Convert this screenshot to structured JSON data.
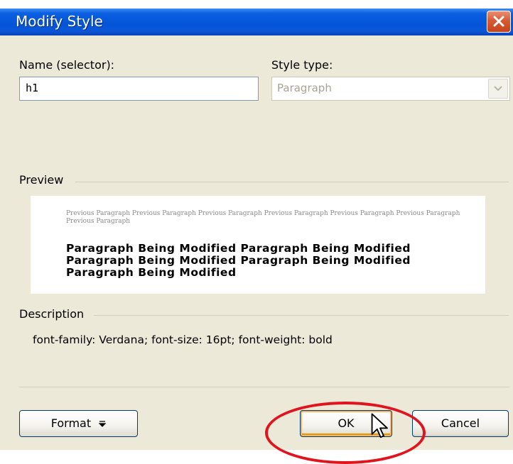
{
  "window": {
    "title": "Modify Style"
  },
  "name_field": {
    "label": "Name (selector):",
    "value": "h1"
  },
  "style_type": {
    "label": "Style type:",
    "value": "Paragraph"
  },
  "preview": {
    "label": "Preview",
    "previous_paragraph": "Previous Paragraph Previous Paragraph Previous Paragraph Previous Paragraph Previous Paragraph Previous Paragraph Previous Paragraph",
    "current_paragraph": "Paragraph Being Modified Paragraph Being Modified Paragraph Being Modified Paragraph Being Modified Paragraph Being Modified"
  },
  "description": {
    "label": "Description",
    "text": "font-family: Verdana; font-size: 16pt; font-weight: bold"
  },
  "buttons": {
    "format": "Format",
    "ok": "OK",
    "cancel": "Cancel"
  },
  "colors": {
    "title_bar": "#0554d8",
    "close_button": "#d85a33",
    "highlight_oval": "#e1141e"
  },
  "icons": {
    "close": "close-icon",
    "dropdown": "chevron-down-icon",
    "format_menu": "menu-arrow-icon",
    "cursor": "mouse-pointer-icon"
  }
}
